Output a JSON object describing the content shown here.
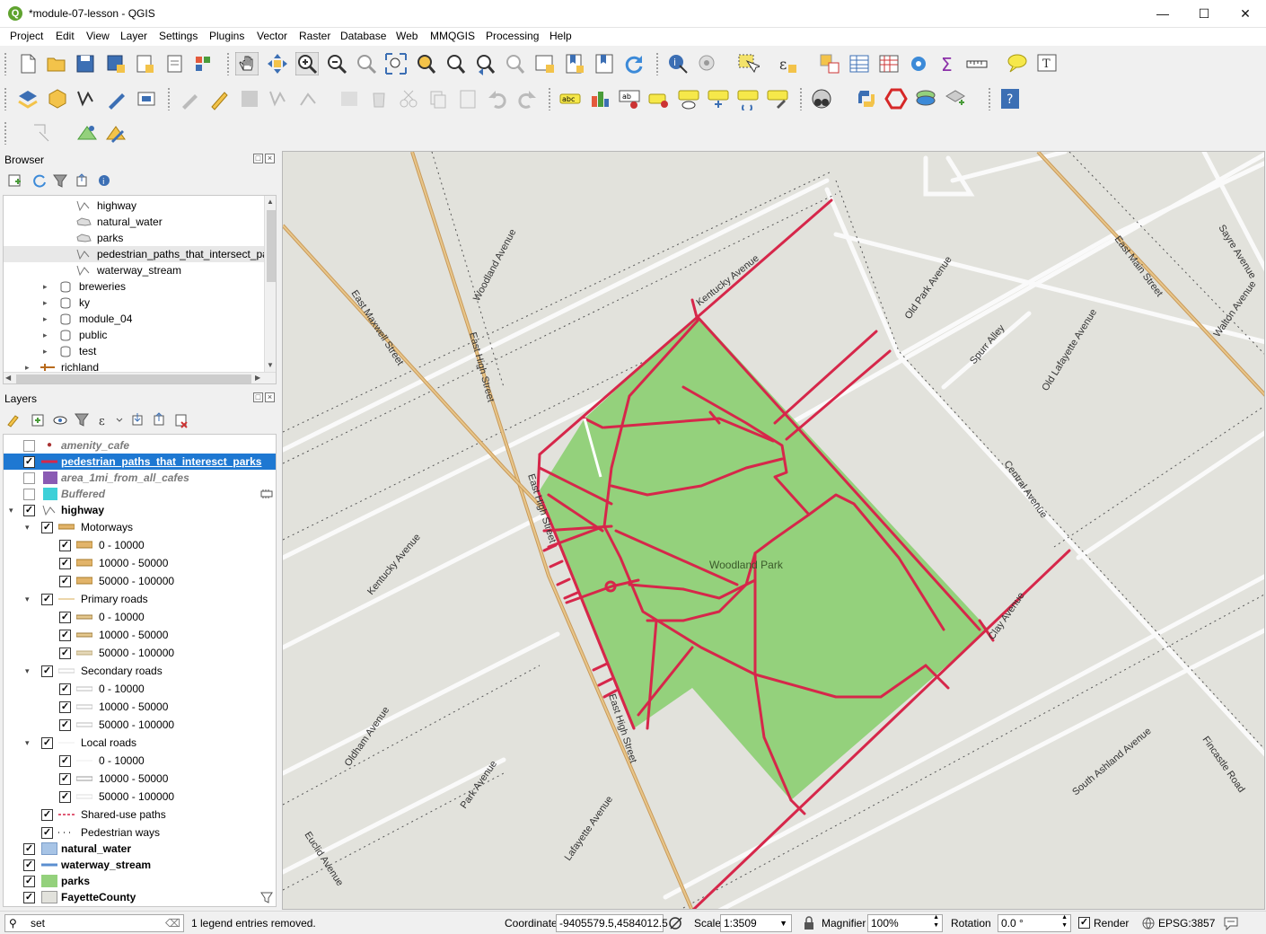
{
  "window": {
    "title": "*module-07-lesson - QGIS",
    "app_icon": "qgis-logo"
  },
  "menu": [
    "Project",
    "Edit",
    "View",
    "Layer",
    "Settings",
    "Plugins",
    "Vector",
    "Raster",
    "Database",
    "Web",
    "MMQGIS",
    "Processing",
    "Help"
  ],
  "browser": {
    "title": "Browser",
    "items": [
      {
        "label": "highway",
        "icon": "line-layer-icon"
      },
      {
        "label": "natural_water",
        "icon": "polygon-layer-icon"
      },
      {
        "label": "parks",
        "icon": "polygon-layer-icon"
      },
      {
        "label": "pedestrian_paths_that_intersect_par",
        "icon": "line-layer-icon"
      },
      {
        "label": "waterway_stream",
        "icon": "line-layer-icon"
      },
      {
        "label": "breweries",
        "icon": "database-icon"
      },
      {
        "label": "ky",
        "icon": "database-icon"
      },
      {
        "label": "module_04",
        "icon": "database-icon"
      },
      {
        "label": "public",
        "icon": "database-icon"
      },
      {
        "label": "test",
        "icon": "database-icon"
      },
      {
        "label": "richland",
        "icon": "connection-icon"
      }
    ]
  },
  "layers": {
    "title": "Layers",
    "items": [
      {
        "label": "amenity_cafe",
        "checked": false
      },
      {
        "label": "pedestrian_paths_that_interesct_parks",
        "checked": true,
        "selected": true
      },
      {
        "label": "area_1mi_from_all_cafes",
        "checked": false
      },
      {
        "label": "Buffered",
        "checked": false
      },
      {
        "label": "highway",
        "checked": true
      },
      {
        "label": "Motorways",
        "checked": true
      },
      {
        "label": "0 - 10000",
        "checked": true
      },
      {
        "label": "10000 - 50000",
        "checked": true
      },
      {
        "label": "50000 - 100000",
        "checked": true
      },
      {
        "label": "Primary roads",
        "checked": true
      },
      {
        "label": "0 - 10000",
        "checked": true
      },
      {
        "label": "10000 - 50000",
        "checked": true
      },
      {
        "label": "50000 - 100000",
        "checked": true
      },
      {
        "label": "Secondary roads",
        "checked": true
      },
      {
        "label": "0 - 10000",
        "checked": true
      },
      {
        "label": "10000 - 50000",
        "checked": true
      },
      {
        "label": "50000 - 100000",
        "checked": true
      },
      {
        "label": "Local roads",
        "checked": true
      },
      {
        "label": "0 - 10000",
        "checked": true
      },
      {
        "label": "10000 - 50000",
        "checked": true
      },
      {
        "label": "50000 - 100000",
        "checked": true
      },
      {
        "label": "Shared-use paths",
        "checked": true
      },
      {
        "label": "Pedestrian ways",
        "checked": true
      },
      {
        "label": "natural_water",
        "checked": true
      },
      {
        "label": "waterway_stream",
        "checked": true
      },
      {
        "label": "parks",
        "checked": true
      },
      {
        "label": "FayetteCounty",
        "checked": true
      }
    ]
  },
  "map": {
    "park_label": "Woodland Park",
    "streets": [
      "Kentucky Avenue",
      "Woodland Avenue",
      "East Maxwell Street",
      "East High Street",
      "Old Park Avenue",
      "Spurr Alley",
      "Old Lafayette Avenue",
      "East Main Street",
      "Sayre Avenue",
      "Walton Avenue",
      "Central Avenue",
      "Kentucky Avenue",
      "East High Street",
      "Clay Avenue",
      "Oldham Avenue",
      "Park Avenue",
      "Euclid Avenue",
      "Lafayette Avenue",
      "South Ashland Avenue",
      "Fincastle Road"
    ],
    "colors": {
      "park": "#94d17c",
      "paths": "#d6274a",
      "background": "#e2e2dc"
    }
  },
  "status": {
    "search_value": "set",
    "message": "1 legend entries removed.",
    "coordinate_label": "Coordinate",
    "coordinate_value": "-9405579.5,4584012.5",
    "scale_label": "Scale",
    "scale_value": "1:3509",
    "magnifier_label": "Magnifier",
    "magnifier_value": "100%",
    "rotation_label": "Rotation",
    "rotation_value": "0.0 °",
    "render_label": "Render",
    "render_checked": true,
    "crs": "EPSG:3857"
  }
}
